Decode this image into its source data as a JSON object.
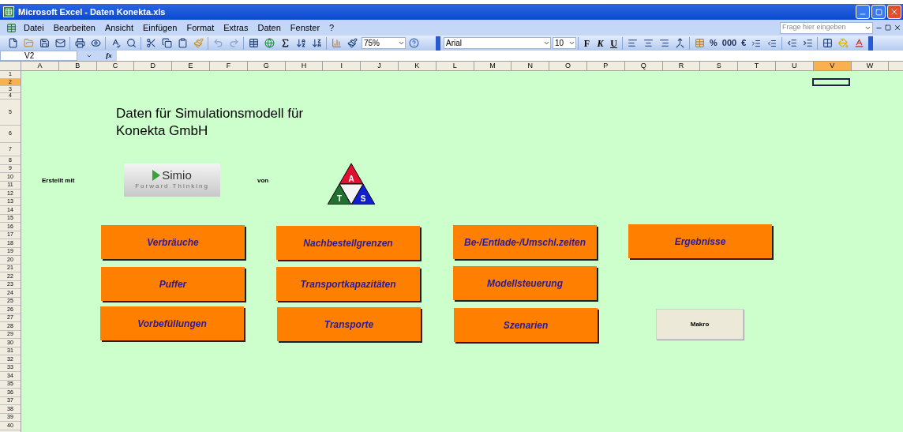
{
  "window": {
    "title": "Microsoft Excel - Daten Konekta.xls"
  },
  "menu": [
    "Datei",
    "Bearbeiten",
    "Ansicht",
    "Einfügen",
    "Format",
    "Extras",
    "Daten",
    "Fenster",
    "?"
  ],
  "help_search": {
    "placeholder": "Frage hier eingeben"
  },
  "toolbar": {
    "zoom": "75%",
    "font": "Arial",
    "font_size": "10",
    "format_buttons": [
      "F",
      "K",
      "U"
    ],
    "number_buttons": [
      "%",
      "000",
      "€"
    ]
  },
  "formula_bar": {
    "name_box": "V2",
    "fx": "fx"
  },
  "columns": [
    {
      "label": "A",
      "selected": false
    },
    {
      "label": "B",
      "selected": false
    },
    {
      "label": "C",
      "selected": false
    },
    {
      "label": "D",
      "selected": false
    },
    {
      "label": "E",
      "selected": false
    },
    {
      "label": "F",
      "selected": false
    },
    {
      "label": "G",
      "selected": false
    },
    {
      "label": "H",
      "selected": false
    },
    {
      "label": "I",
      "selected": false
    },
    {
      "label": "J",
      "selected": false
    },
    {
      "label": "K",
      "selected": false
    },
    {
      "label": "L",
      "selected": false
    },
    {
      "label": "M",
      "selected": false
    },
    {
      "label": "N",
      "selected": false
    },
    {
      "label": "O",
      "selected": false
    },
    {
      "label": "P",
      "selected": false
    },
    {
      "label": "Q",
      "selected": false
    },
    {
      "label": "R",
      "selected": false
    },
    {
      "label": "S",
      "selected": false
    },
    {
      "label": "T",
      "selected": false
    },
    {
      "label": "U",
      "selected": false
    },
    {
      "label": "V",
      "selected": true
    },
    {
      "label": "W",
      "selected": false
    }
  ],
  "rows": [
    {
      "label": "1",
      "selected": false
    },
    {
      "label": "2",
      "selected": true
    },
    {
      "label": "3",
      "selected": false
    },
    {
      "label": "4",
      "selected": false
    },
    {
      "label": "5",
      "selected": false
    },
    {
      "label": "6",
      "selected": false
    },
    {
      "label": "7",
      "selected": false
    },
    {
      "label": "8",
      "selected": false
    },
    {
      "label": "9",
      "selected": false
    },
    {
      "label": "10",
      "selected": false
    },
    {
      "label": "11",
      "selected": false
    },
    {
      "label": "12",
      "selected": false
    },
    {
      "label": "13",
      "selected": false
    },
    {
      "label": "14",
      "selected": false
    },
    {
      "label": "15",
      "selected": false
    },
    {
      "label": "16",
      "selected": false
    },
    {
      "label": "17",
      "selected": false
    },
    {
      "label": "18",
      "selected": false
    },
    {
      "label": "19",
      "selected": false
    },
    {
      "label": "20",
      "selected": false
    },
    {
      "label": "21",
      "selected": false
    },
    {
      "label": "22",
      "selected": false
    },
    {
      "label": "23",
      "selected": false
    },
    {
      "label": "24",
      "selected": false
    },
    {
      "label": "25",
      "selected": false
    },
    {
      "label": "26",
      "selected": false
    },
    {
      "label": "27",
      "selected": false
    },
    {
      "label": "28",
      "selected": false
    },
    {
      "label": "29",
      "selected": false
    },
    {
      "label": "30",
      "selected": false
    },
    {
      "label": "31",
      "selected": false
    },
    {
      "label": "32",
      "selected": false
    },
    {
      "label": "33",
      "selected": false
    },
    {
      "label": "34",
      "selected": false
    },
    {
      "label": "35",
      "selected": false
    },
    {
      "label": "36",
      "selected": false
    },
    {
      "label": "37",
      "selected": false
    },
    {
      "label": "38",
      "selected": false
    },
    {
      "label": "39",
      "selected": false
    },
    {
      "label": "40",
      "selected": false
    }
  ],
  "sheet": {
    "title_lines": [
      "Daten für Simulationsmodell für",
      "Konekta GmbH"
    ],
    "created_with": "Erstellt mit",
    "by": "von",
    "simio_logo": {
      "name": "Simio",
      "tagline": "Forward Thinking"
    },
    "ats_logo": [
      "A",
      "T",
      "S"
    ],
    "buttons": [
      {
        "label": "Verbräuche",
        "kind": "nav"
      },
      {
        "label": "Nachbestellgrenzen",
        "kind": "nav"
      },
      {
        "label": "Be-/Entlade-/Umschl.zeiten",
        "kind": "nav"
      },
      {
        "label": "Ergebnisse",
        "kind": "nav"
      },
      {
        "label": "Puffer",
        "kind": "nav"
      },
      {
        "label": "Transportkapazitäten",
        "kind": "nav"
      },
      {
        "label": "Modellsteuerung",
        "kind": "nav"
      },
      {
        "label": "Vorbefüllungen",
        "kind": "nav"
      },
      {
        "label": "Transporte",
        "kind": "nav"
      },
      {
        "label": "Szenarien",
        "kind": "nav"
      },
      {
        "label": "Makro",
        "kind": "macro"
      }
    ]
  }
}
